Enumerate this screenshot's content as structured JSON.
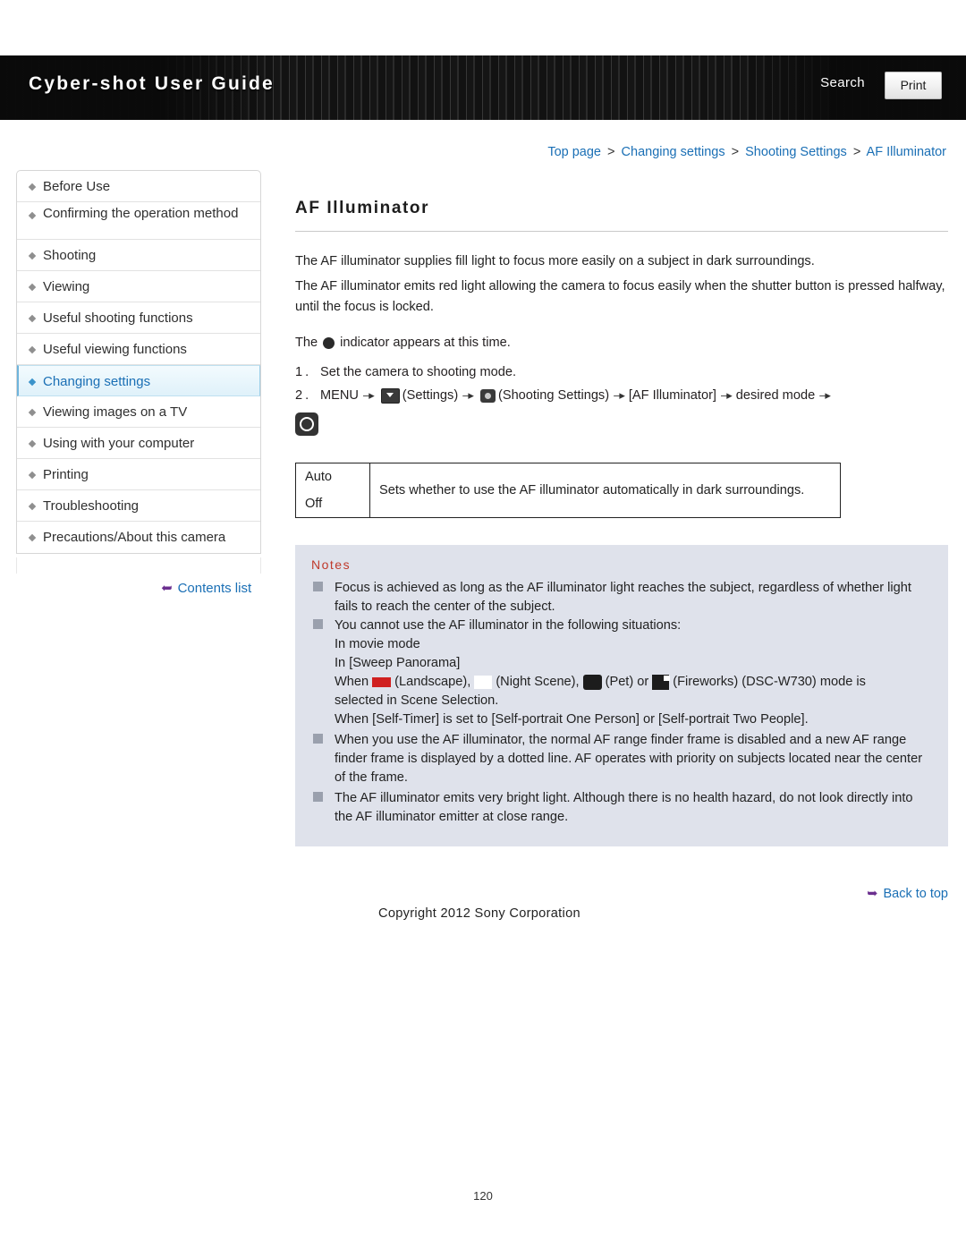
{
  "header": {
    "title": "Cyber-shot User Guide",
    "search_label": "Search",
    "print_label": "Print"
  },
  "breadcrumb": {
    "top": "Top page",
    "level2": "Changing settings",
    "level3": "Shooting Settings",
    "current": "AF Illuminator",
    "separator": ">"
  },
  "sidebar": {
    "items": [
      {
        "label": "Before Use"
      },
      {
        "label": "Confirming the operation method"
      },
      {
        "label": "Shooting"
      },
      {
        "label": "Viewing"
      },
      {
        "label": "Useful shooting functions"
      },
      {
        "label": "Useful viewing functions"
      },
      {
        "label": "Changing settings"
      },
      {
        "label": "Viewing images on a TV"
      },
      {
        "label": "Using with your computer"
      },
      {
        "label": "Printing"
      },
      {
        "label": "Troubleshooting"
      },
      {
        "label": "Precautions/About this camera"
      }
    ],
    "contents_list": "Contents list"
  },
  "page": {
    "title": "AF Illuminator",
    "para1": "The AF illuminator supplies fill light to focus more easily on a subject in dark surroundings.",
    "para2": "The AF illuminator emits red light allowing the camera to focus easily when the shutter button is pressed halfway, until the focus is locked.",
    "indicator_pre": "The",
    "indicator_post": "indicator appears at this time.",
    "step1_num": "1.",
    "step1_text": "Set the camera to shooting mode.",
    "step2_num": "2.",
    "step2_menu": "MENU",
    "step2_settings": "(Settings)",
    "step2_shooting_settings": "(Shooting Settings)",
    "step2_af": "[AF Illuminator]",
    "step2_desired": "desired mode",
    "table": {
      "rows": [
        {
          "key": "Auto"
        },
        {
          "key": "Off"
        }
      ],
      "description": "Sets whether to use the AF illuminator automatically in dark surroundings."
    },
    "notes_title": "Notes",
    "notes": [
      "Focus is achieved as long as the AF illuminator light reaches the subject, regardless of whether light fails to reach the center of the subject.",
      "You cannot use the AF illuminator in the following situations:",
      "When you use the AF illuminator, the normal AF range finder frame is disabled and a new AF range finder frame is displayed by a dotted line. AF operates with priority on subjects located near the center of the frame.",
      "The AF illuminator emits very bright light. Although there is no health hazard, do not look directly into the AF illuminator emitter at close range."
    ],
    "note_sub_items": [
      "In movie mode",
      "In [Sweep Panorama]"
    ],
    "note_scene_pre": "When",
    "note_scene_landscape": "(Landscape),",
    "note_scene_night": "(Night Scene),",
    "note_scene_pet": "(Pet) or",
    "note_scene_fireworks": "(Fireworks) (DSC-W730) mode is",
    "note_scene_tail": "selected in Scene Selection.",
    "note_selftimer": "When [Self-Timer] is set to [Self-portrait One Person] or [Self-portrait Two People]."
  },
  "footer": {
    "back_to_top": "Back to top",
    "copyright": "Copyright 2012 Sony Corporation",
    "page_number": "120"
  }
}
